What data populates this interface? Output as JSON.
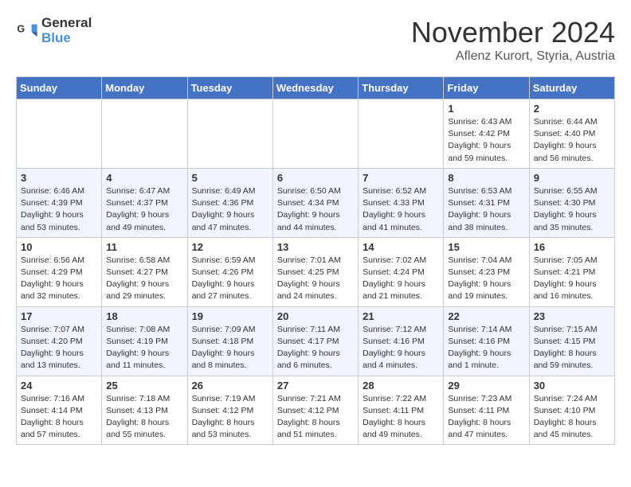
{
  "logo": {
    "text_general": "General",
    "text_blue": "Blue"
  },
  "title": "November 2024",
  "subtitle": "Aflenz Kurort, Styria, Austria",
  "days_of_week": [
    "Sunday",
    "Monday",
    "Tuesday",
    "Wednesday",
    "Thursday",
    "Friday",
    "Saturday"
  ],
  "weeks": [
    [
      {
        "day": "",
        "info": ""
      },
      {
        "day": "",
        "info": ""
      },
      {
        "day": "",
        "info": ""
      },
      {
        "day": "",
        "info": ""
      },
      {
        "day": "",
        "info": ""
      },
      {
        "day": "1",
        "info": "Sunrise: 6:43 AM\nSunset: 4:42 PM\nDaylight: 9 hours\nand 59 minutes."
      },
      {
        "day": "2",
        "info": "Sunrise: 6:44 AM\nSunset: 4:40 PM\nDaylight: 9 hours\nand 56 minutes."
      }
    ],
    [
      {
        "day": "3",
        "info": "Sunrise: 6:46 AM\nSunset: 4:39 PM\nDaylight: 9 hours\nand 53 minutes."
      },
      {
        "day": "4",
        "info": "Sunrise: 6:47 AM\nSunset: 4:37 PM\nDaylight: 9 hours\nand 49 minutes."
      },
      {
        "day": "5",
        "info": "Sunrise: 6:49 AM\nSunset: 4:36 PM\nDaylight: 9 hours\nand 47 minutes."
      },
      {
        "day": "6",
        "info": "Sunrise: 6:50 AM\nSunset: 4:34 PM\nDaylight: 9 hours\nand 44 minutes."
      },
      {
        "day": "7",
        "info": "Sunrise: 6:52 AM\nSunset: 4:33 PM\nDaylight: 9 hours\nand 41 minutes."
      },
      {
        "day": "8",
        "info": "Sunrise: 6:53 AM\nSunset: 4:31 PM\nDaylight: 9 hours\nand 38 minutes."
      },
      {
        "day": "9",
        "info": "Sunrise: 6:55 AM\nSunset: 4:30 PM\nDaylight: 9 hours\nand 35 minutes."
      }
    ],
    [
      {
        "day": "10",
        "info": "Sunrise: 6:56 AM\nSunset: 4:29 PM\nDaylight: 9 hours\nand 32 minutes."
      },
      {
        "day": "11",
        "info": "Sunrise: 6:58 AM\nSunset: 4:27 PM\nDaylight: 9 hours\nand 29 minutes."
      },
      {
        "day": "12",
        "info": "Sunrise: 6:59 AM\nSunset: 4:26 PM\nDaylight: 9 hours\nand 27 minutes."
      },
      {
        "day": "13",
        "info": "Sunrise: 7:01 AM\nSunset: 4:25 PM\nDaylight: 9 hours\nand 24 minutes."
      },
      {
        "day": "14",
        "info": "Sunrise: 7:02 AM\nSunset: 4:24 PM\nDaylight: 9 hours\nand 21 minutes."
      },
      {
        "day": "15",
        "info": "Sunrise: 7:04 AM\nSunset: 4:23 PM\nDaylight: 9 hours\nand 19 minutes."
      },
      {
        "day": "16",
        "info": "Sunrise: 7:05 AM\nSunset: 4:21 PM\nDaylight: 9 hours\nand 16 minutes."
      }
    ],
    [
      {
        "day": "17",
        "info": "Sunrise: 7:07 AM\nSunset: 4:20 PM\nDaylight: 9 hours\nand 13 minutes."
      },
      {
        "day": "18",
        "info": "Sunrise: 7:08 AM\nSunset: 4:19 PM\nDaylight: 9 hours\nand 11 minutes."
      },
      {
        "day": "19",
        "info": "Sunrise: 7:09 AM\nSunset: 4:18 PM\nDaylight: 9 hours\nand 8 minutes."
      },
      {
        "day": "20",
        "info": "Sunrise: 7:11 AM\nSunset: 4:17 PM\nDaylight: 9 hours\nand 6 minutes."
      },
      {
        "day": "21",
        "info": "Sunrise: 7:12 AM\nSunset: 4:16 PM\nDaylight: 9 hours\nand 4 minutes."
      },
      {
        "day": "22",
        "info": "Sunrise: 7:14 AM\nSunset: 4:16 PM\nDaylight: 9 hours\nand 1 minute."
      },
      {
        "day": "23",
        "info": "Sunrise: 7:15 AM\nSunset: 4:15 PM\nDaylight: 8 hours\nand 59 minutes."
      }
    ],
    [
      {
        "day": "24",
        "info": "Sunrise: 7:16 AM\nSunset: 4:14 PM\nDaylight: 8 hours\nand 57 minutes."
      },
      {
        "day": "25",
        "info": "Sunrise: 7:18 AM\nSunset: 4:13 PM\nDaylight: 8 hours\nand 55 minutes."
      },
      {
        "day": "26",
        "info": "Sunrise: 7:19 AM\nSunset: 4:12 PM\nDaylight: 8 hours\nand 53 minutes."
      },
      {
        "day": "27",
        "info": "Sunrise: 7:21 AM\nSunset: 4:12 PM\nDaylight: 8 hours\nand 51 minutes."
      },
      {
        "day": "28",
        "info": "Sunrise: 7:22 AM\nSunset: 4:11 PM\nDaylight: 8 hours\nand 49 minutes."
      },
      {
        "day": "29",
        "info": "Sunrise: 7:23 AM\nSunset: 4:11 PM\nDaylight: 8 hours\nand 47 minutes."
      },
      {
        "day": "30",
        "info": "Sunrise: 7:24 AM\nSunset: 4:10 PM\nDaylight: 8 hours\nand 45 minutes."
      }
    ]
  ]
}
